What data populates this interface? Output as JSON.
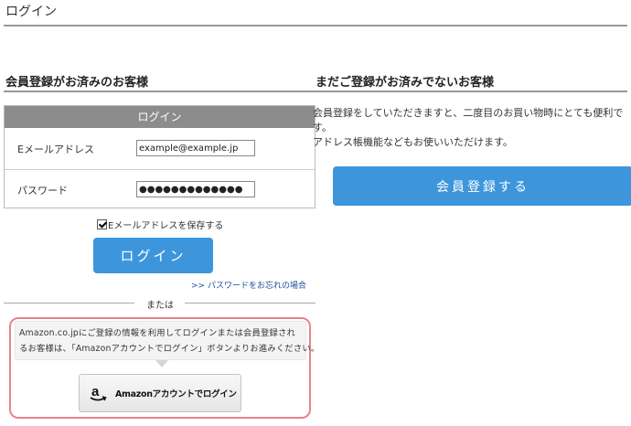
{
  "page": {
    "title": "ログイン"
  },
  "member": {
    "heading": "会員登録がお済みのお客様",
    "box_header": "ログイン",
    "email_label": "Eメールアドレス",
    "email_value": "example@example.jp",
    "password_label": "パスワード",
    "password_value": "●●●●●●●●●●●●●",
    "remember_label": "Eメールアドレスを保存する",
    "remember_checked": true,
    "login_button": "ログイン",
    "forgot_link": ">> パスワードをお忘れの場合",
    "or_text": "または"
  },
  "amazon": {
    "message_line1": "Amazon.co.jpにご登録の情報を利用してログインまたは会員登録され",
    "message_line2": "るお客様は、「Amazonアカウントでログイン」ボタンよりお進みください。",
    "button_label": "Amazonアカウントでログイン",
    "logo_letter": "a",
    "panel_border_color": "#e8848a"
  },
  "guest": {
    "heading": "まだご登録がお済みでないお客様",
    "text_line1": "会員登録をしていただきますと、二度目のお買い物時にとても便利で",
    "text_line2": "す。",
    "text_line3": "アドレス帳機能などもお使いいただけます。",
    "register_button": "会員登録する"
  },
  "colors": {
    "button_blue": "#3d96dc",
    "header_gray": "#8c8c8c",
    "link_blue": "#1a4fa0"
  }
}
